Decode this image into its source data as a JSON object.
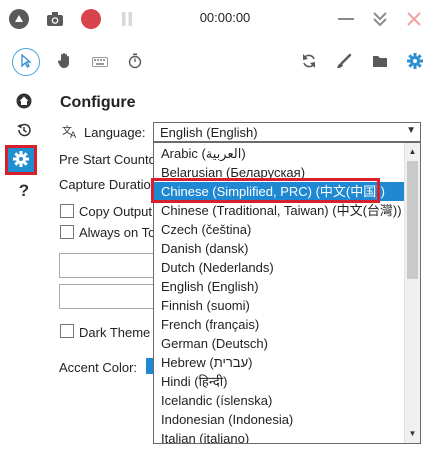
{
  "topbar": {
    "timer": "00:00:00"
  },
  "settings": {
    "heading": "Configure",
    "language_label": "Language:",
    "language_value": "English (English)",
    "pre_start_label": "Pre Start Countd",
    "capture_label": "Capture Duratio",
    "copy_output_label": "Copy Output",
    "always_on_top_label": "Always on To",
    "dark_theme_label": "Dark Theme",
    "accent_label": "Accent Color:"
  },
  "dropdown": {
    "items": [
      "Arabic (العربية)",
      "Belarusian (Беларуская)",
      "Chinese (Simplified, PRC) (中文(中国))",
      "Chinese (Traditional, Taiwan) (中文(台灣))",
      "Czech (čeština)",
      "Danish (dansk)",
      "Dutch (Nederlands)",
      "English (English)",
      "Finnish (suomi)",
      "French (français)",
      "German (Deutsch)",
      "Hebrew (עברית)",
      "Hindi (हिन्दी)",
      "Icelandic (íslenska)",
      "Indonesian (Indonesia)",
      "Italian (italiano)"
    ],
    "selected_index": 2
  },
  "colors": {
    "accent": "#1e88d3",
    "highlight_outline": "#d71f2e",
    "record_red": "#d9434e"
  },
  "icons": {
    "top": [
      "stop-icon",
      "camera-icon",
      "record-icon",
      "pause-icon"
    ],
    "window": [
      "minimize-icon",
      "collapse-icon",
      "close-icon"
    ],
    "tools": [
      "pointer-icon",
      "hand-icon",
      "keyboard-icon",
      "timer-icon",
      "refresh-icon",
      "brush-icon",
      "folder-icon",
      "gear-icon"
    ],
    "sidebar": [
      "home-icon",
      "history-icon",
      "gear-icon",
      "help-icon"
    ]
  }
}
